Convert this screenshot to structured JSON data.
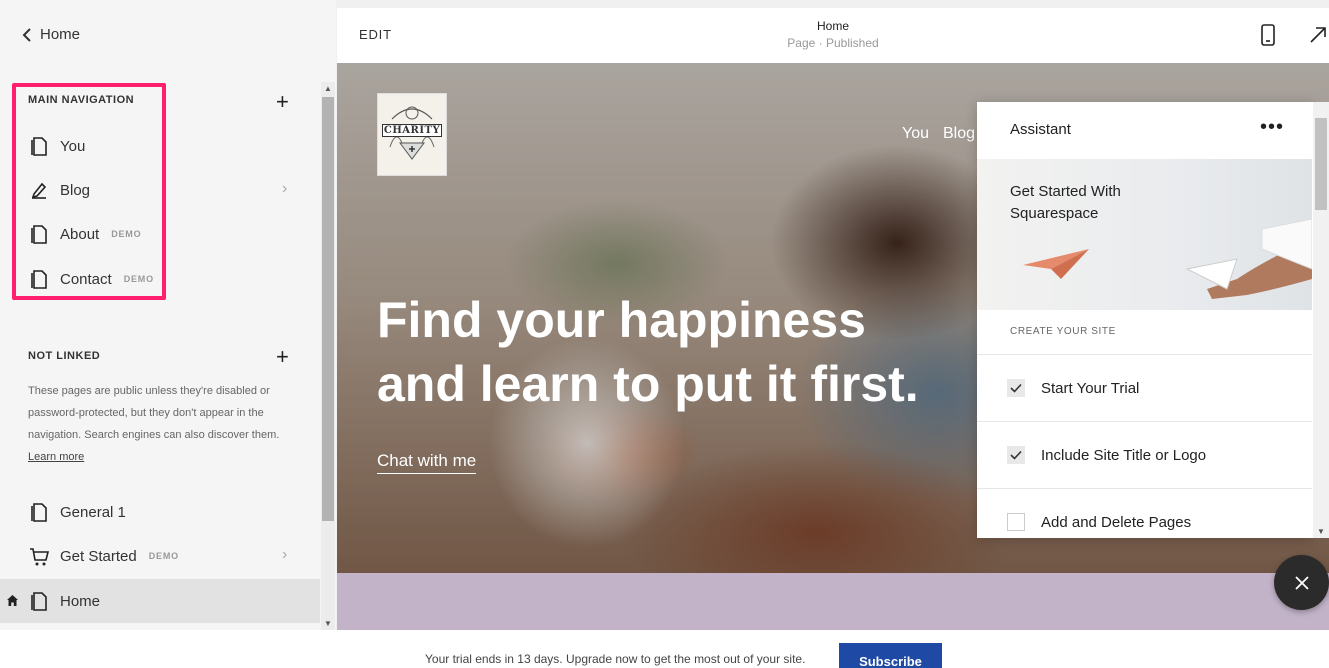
{
  "sidebar": {
    "back_label": "Home",
    "main_nav_title": "MAIN NAVIGATION",
    "main_nav": [
      {
        "label": "You",
        "badge": "",
        "icon": "page-icon"
      },
      {
        "label": "Blog",
        "badge": "",
        "icon": "blog-icon"
      },
      {
        "label": "About",
        "badge": "DEMO",
        "icon": "page-icon"
      },
      {
        "label": "Contact",
        "badge": "DEMO",
        "icon": "page-icon"
      }
    ],
    "not_linked_title": "NOT LINKED",
    "not_linked_desc": "These pages are public unless they're disabled or password-protected, but they don't appear in the navigation. Search engines can also discover them.",
    "learn_more": "Learn more",
    "not_linked": [
      {
        "label": "General 1",
        "badge": "",
        "icon": "page-icon"
      },
      {
        "label": "Get Started",
        "badge": "DEMO",
        "icon": "cart-icon"
      },
      {
        "label": "Home",
        "badge": "",
        "icon": "page-icon"
      }
    ]
  },
  "topbar": {
    "edit_label": "EDIT",
    "page_title": "Home",
    "page_status": "Page · Published"
  },
  "hero": {
    "logo_text": "CHARITY",
    "nav": [
      "You",
      "Blog"
    ],
    "headline_line1": "Find your happiness",
    "headline_line2": "and learn to put it first.",
    "cta": "Chat with me"
  },
  "assistant": {
    "title": "Assistant",
    "more": "•••",
    "banner_text": "Get Started With Squarespace",
    "section_label": "CREATE YOUR SITE",
    "items": [
      {
        "label": "Start Your Trial",
        "checked": true
      },
      {
        "label": "Include Site Title or Logo",
        "checked": true
      },
      {
        "label": "Add and Delete Pages",
        "checked": false
      }
    ]
  },
  "footer": {
    "trial_text": "Your trial ends in 13 days. Upgrade now to get the most out of your site.",
    "subscribe_label": "Subscribe"
  },
  "colors": {
    "highlight": "#ff1f6e",
    "subscribe": "#1e4aa6",
    "band": "#c2b3c9"
  }
}
